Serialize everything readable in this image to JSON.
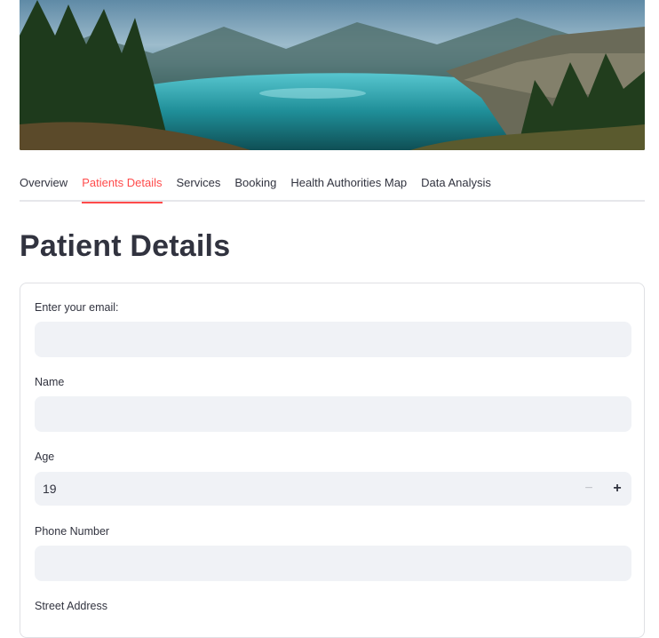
{
  "banner": {
    "alt": "Mountain lake with pine forest"
  },
  "tabs": [
    {
      "label": "Overview",
      "active": false
    },
    {
      "label": "Patients Details",
      "active": true
    },
    {
      "label": "Services",
      "active": false
    },
    {
      "label": "Booking",
      "active": false
    },
    {
      "label": "Health Authorities Map",
      "active": false
    },
    {
      "label": "Data Analysis",
      "active": false
    }
  ],
  "page_title": "Patient Details",
  "form": {
    "email": {
      "label": "Enter your email:",
      "value": ""
    },
    "name": {
      "label": "Name",
      "value": ""
    },
    "age": {
      "label": "Age",
      "value": "19",
      "minus_icon": "minus-icon",
      "plus_icon": "plus-icon"
    },
    "phone": {
      "label": "Phone Number",
      "value": ""
    },
    "street": {
      "label": "Street Address"
    }
  },
  "colors": {
    "accent": "#ff4b4b",
    "input_bg": "#f0f2f6",
    "text": "#31333f"
  }
}
